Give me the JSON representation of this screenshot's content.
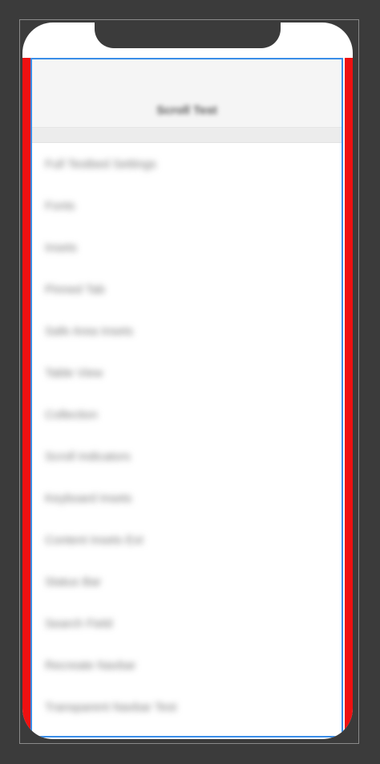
{
  "nav": {
    "title": "Scroll Test"
  },
  "list": {
    "items": [
      "Full Testbed Settings",
      "Fonts",
      "Insets",
      "Pinned Tab",
      "Safe Area Insets",
      "Table View",
      "Collection",
      "Scroll Indicators",
      "Keyboard Insets",
      "Content Insets Ext",
      "Status Bar",
      "Search Field",
      "Recreate Navbar",
      "Transparent Navbar Test"
    ]
  },
  "colors": {
    "background": "#3b3b3b",
    "sideBars": "#ee1111",
    "safeAreaOutline": "#3a8de8"
  }
}
